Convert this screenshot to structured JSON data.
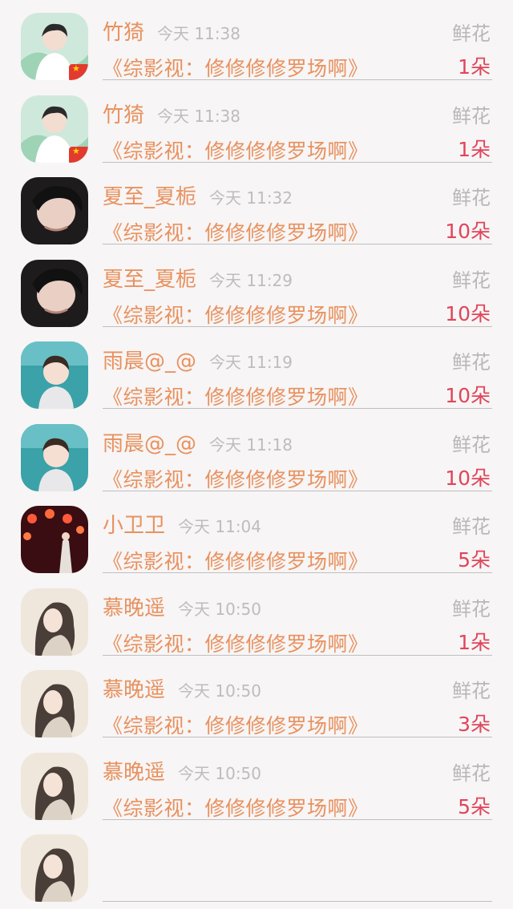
{
  "rows": [
    {
      "name": "竹猗",
      "time": "今天 11:38",
      "gift": "鲜花",
      "title": "《综影视：修修修修罗场啊》",
      "count": "1朵",
      "avatar": "avatar-a",
      "flag": true
    },
    {
      "name": "竹猗",
      "time": "今天 11:38",
      "gift": "鲜花",
      "title": "《综影视：修修修修罗场啊》",
      "count": "1朵",
      "avatar": "avatar-a",
      "flag": true
    },
    {
      "name": "夏至_夏栀",
      "time": "今天 11:32",
      "gift": "鲜花",
      "title": "《综影视：修修修修罗场啊》",
      "count": "10朵",
      "avatar": "avatar-b",
      "flag": false
    },
    {
      "name": "夏至_夏栀",
      "time": "今天 11:29",
      "gift": "鲜花",
      "title": "《综影视：修修修修罗场啊》",
      "count": "10朵",
      "avatar": "avatar-b",
      "flag": false
    },
    {
      "name": "雨晨@_@",
      "time": "今天 11:19",
      "gift": "鲜花",
      "title": "《综影视：修修修修罗场啊》",
      "count": "10朵",
      "avatar": "avatar-c",
      "flag": false
    },
    {
      "name": "雨晨@_@",
      "time": "今天 11:18",
      "gift": "鲜花",
      "title": "《综影视：修修修修罗场啊》",
      "count": "10朵",
      "avatar": "avatar-c",
      "flag": false
    },
    {
      "name": "小卫卫",
      "time": "今天 11:04",
      "gift": "鲜花",
      "title": "《综影视：修修修修罗场啊》",
      "count": "5朵",
      "avatar": "avatar-d",
      "flag": false
    },
    {
      "name": "慕晚遥",
      "time": "今天 10:50",
      "gift": "鲜花",
      "title": "《综影视：修修修修罗场啊》",
      "count": "1朵",
      "avatar": "avatar-e",
      "flag": false
    },
    {
      "name": "慕晚遥",
      "time": "今天 10:50",
      "gift": "鲜花",
      "title": "《综影视：修修修修罗场啊》",
      "count": "3朵",
      "avatar": "avatar-e",
      "flag": false
    },
    {
      "name": "慕晚遥",
      "time": "今天 10:50",
      "gift": "鲜花",
      "title": "《综影视：修修修修罗场啊》",
      "count": "5朵",
      "avatar": "avatar-e",
      "flag": false
    },
    {
      "name": "",
      "time": "",
      "gift": "",
      "title": "",
      "count": "",
      "avatar": "avatar-e",
      "flag": false
    }
  ],
  "colors": {
    "name": "#e8915f",
    "time": "#bdbdbd",
    "gift": "#b8b8b8",
    "count": "#e0455a",
    "divider": "#bfbfbf",
    "background": "#f7f5f5"
  }
}
